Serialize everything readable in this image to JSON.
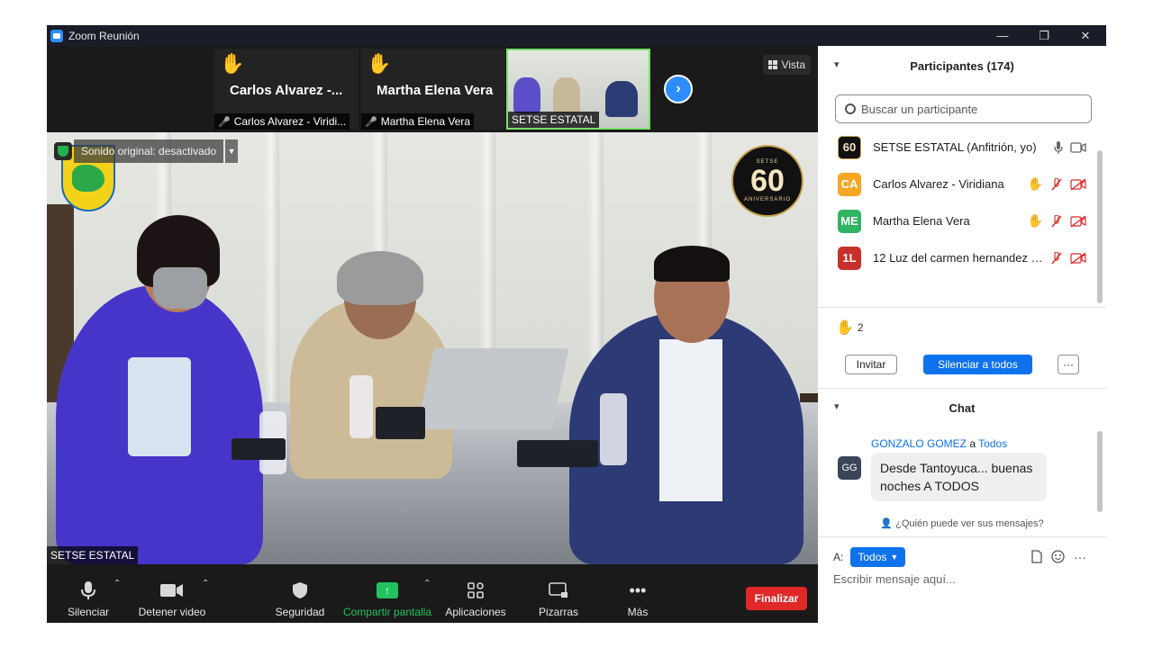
{
  "window": {
    "title": "Zoom Reunión",
    "minimize": "—",
    "maximize": "❐",
    "close": "✕"
  },
  "filmstrip": {
    "tiles": [
      {
        "big_name": "Carlos Alvarez -...",
        "small_name": "Carlos Alvarez - Viridi..."
      },
      {
        "big_name": "Martha Elena Vera",
        "small_name": "Martha Elena Vera"
      },
      {
        "small_name": "SETSE ESTATAL"
      }
    ],
    "vista_label": "Vista",
    "next_icon": "chevron-right-icon"
  },
  "main_video": {
    "sound_original": "Sonido original: desactivado",
    "speaker_label": "SETSE ESTATAL",
    "anniversary_number": "60",
    "anniversary_top": "SETSE",
    "anniversary_bottom": "ANIVERSARIO"
  },
  "toolbar": {
    "mute": "Silenciar",
    "video": "Detener video",
    "security": "Seguridad",
    "share": "Compartir pantalla",
    "apps": "Aplicaciones",
    "whiteboards": "Pizarras",
    "more": "Más",
    "end": "Finalizar"
  },
  "participants": {
    "title": "Participantes (174)",
    "search_placeholder": "Buscar un participante",
    "list": [
      {
        "initials": "60",
        "name": "SETSE ESTATAL (Anfitrión, yo)",
        "color": "#111111"
      },
      {
        "initials": "CA",
        "name": "Carlos Alvarez - Viridiana",
        "color": "#f5a623"
      },
      {
        "initials": "ME",
        "name": "Martha Elena Vera",
        "color": "#2fb463"
      },
      {
        "initials": "1L",
        "name": "12 Luz del carmen hernandez h...",
        "color": "#c9302c"
      }
    ],
    "raised_hands": "2",
    "invite": "Invitar",
    "mute_all": "Silenciar a todos",
    "more": "···"
  },
  "chat": {
    "title": "Chat",
    "message": {
      "sender": "GONZALO GOMEZ",
      "connector": "a",
      "recipient": "Todos",
      "initials": "GG",
      "text": "Desde Tantoyuca... buenas noches A TODOS"
    },
    "who_sees": "¿Quién puede ver sus mensajes?",
    "to_label": "A:",
    "to_value": "Todos",
    "input_placeholder": "Escribir mensaje aquí..."
  },
  "colors": {
    "accent": "#0e72ed",
    "end": "#e02828",
    "share": "#22c35e",
    "raise_hand": "#f5b400"
  }
}
